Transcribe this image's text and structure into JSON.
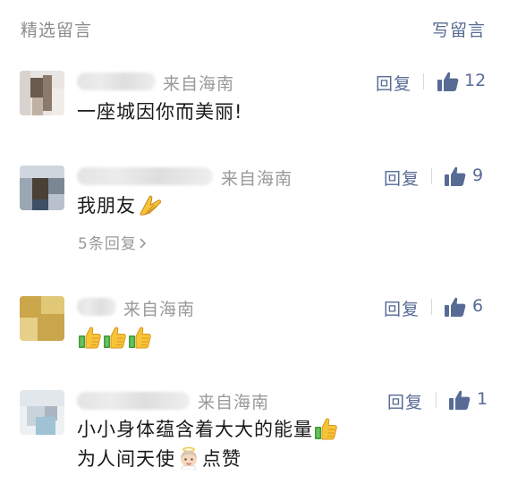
{
  "header": {
    "title": "精选留言",
    "write_label": "写留言"
  },
  "comments": [
    {
      "location": "来自海南",
      "reply_label": "回复",
      "likes": "12",
      "text": "一座城因你而美丽!"
    },
    {
      "location": "来自海南",
      "reply_label": "回复",
      "likes": "9",
      "text": "我朋友",
      "sub_replies": "5条回复"
    },
    {
      "location": "来自海南",
      "reply_label": "回复",
      "likes": "6"
    },
    {
      "location": "来自海南",
      "reply_label": "回复",
      "likes": "1",
      "text_line1": "小小身体蕴含着大大的能量",
      "text_line2a": "为人间天使",
      "text_line2b": "点赞"
    }
  ],
  "icons": {
    "like": "thumbs-up-icon",
    "thumb_emoji": "thumbs-up-emoji",
    "pray_emoji": "folded-hands-emoji",
    "angel_emoji": "baby-angel-emoji",
    "sub_reply_arrow": "chevron-right-icon"
  },
  "colors": {
    "link": "#576b95",
    "muted": "#9a9a9a",
    "text": "#1a1a1a"
  }
}
